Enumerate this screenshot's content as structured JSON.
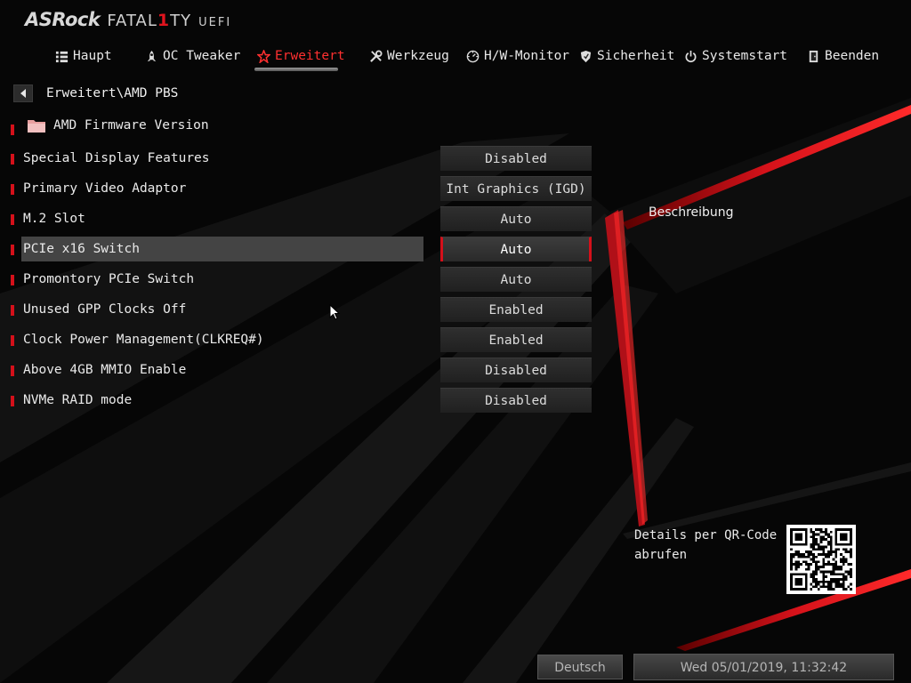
{
  "logo": {
    "brand": "ASRock",
    "line_a": "FATAL",
    "line_one": "1",
    "line_b": "TY",
    "uefi": "UEFI"
  },
  "nav": {
    "items": [
      {
        "label": "Haupt",
        "icon": "list-icon"
      },
      {
        "label": "OC Tweaker",
        "icon": "rocket-icon"
      },
      {
        "label": "Erweitert",
        "icon": "star-icon",
        "active": true
      },
      {
        "label": "Werkzeug",
        "icon": "tools-icon"
      },
      {
        "label": "H/W-Monitor",
        "icon": "monitor-gauge-icon"
      },
      {
        "label": "Sicherheit",
        "icon": "shield-icon"
      },
      {
        "label": "Systemstart",
        "icon": "power-icon"
      },
      {
        "label": "Beenden",
        "icon": "exit-door-icon"
      }
    ]
  },
  "breadcrumb": {
    "path": "Erweitert\\AMD PBS"
  },
  "folder": {
    "label": "AMD Firmware Version"
  },
  "settings": [
    {
      "label": "Special Display Features",
      "value": "Disabled"
    },
    {
      "label": "Primary Video Adaptor",
      "value": "Int Graphics (IGD)"
    },
    {
      "label": "M.2 Slot",
      "value": "Auto"
    },
    {
      "label": "PCIe x16 Switch",
      "value": "Auto",
      "selected": true
    },
    {
      "label": "Promontory PCIe Switch",
      "value": "Auto"
    },
    {
      "label": "Unused GPP Clocks Off",
      "value": "Enabled"
    },
    {
      "label": "Clock Power Management(CLKREQ#)",
      "value": "Enabled"
    },
    {
      "label": "Above 4GB MMIO Enable",
      "value": "Disabled"
    },
    {
      "label": "NVMe RAID mode",
      "value": "Disabled"
    }
  ],
  "description": {
    "title": "Beschreibung"
  },
  "qr": {
    "line1": "Details per QR-Code",
    "line2": "abrufen"
  },
  "footer": {
    "language": "Deutsch",
    "datetime": "Wed 05/01/2019, 11:32:42"
  },
  "colors": {
    "accent": "#d4101a",
    "active_tab": "#ff3030",
    "background": "#050505",
    "selected_row": "#444444"
  }
}
